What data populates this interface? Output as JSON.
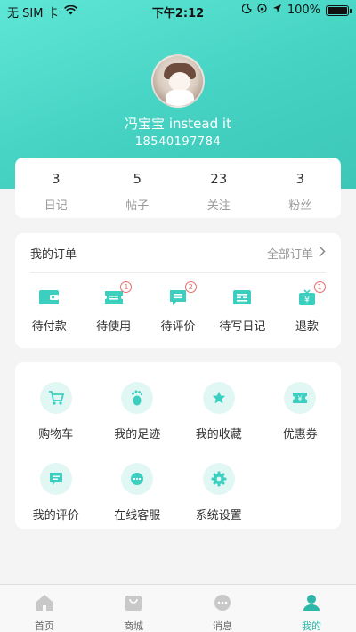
{
  "status_bar": {
    "carrier": "无 SIM 卡",
    "time": "下午2:12",
    "battery": "100%"
  },
  "profile": {
    "name": "冯宝宝 instead it",
    "phone": "18540197784"
  },
  "stats": [
    {
      "value": "3",
      "label": "日记"
    },
    {
      "value": "5",
      "label": "帖子"
    },
    {
      "value": "23",
      "label": "关注"
    },
    {
      "value": "3",
      "label": "粉丝"
    }
  ],
  "orders": {
    "title": "我的订单",
    "all_label": "全部订单",
    "items": [
      {
        "label": "待付款",
        "icon": "wallet-icon"
      },
      {
        "label": "待使用",
        "icon": "ticket-icon",
        "badge": "1"
      },
      {
        "label": "待评价",
        "icon": "comment-icon",
        "badge": "2"
      },
      {
        "label": "待写日记",
        "icon": "diary-icon"
      },
      {
        "label": "退款",
        "icon": "refund-icon",
        "badge": "1"
      }
    ]
  },
  "services": [
    {
      "label": "购物车",
      "icon": "cart-icon"
    },
    {
      "label": "我的足迹",
      "icon": "footprint-icon"
    },
    {
      "label": "我的收藏",
      "icon": "star-icon"
    },
    {
      "label": "优惠券",
      "icon": "coupon-icon"
    },
    {
      "label": "我的评价",
      "icon": "review-icon"
    },
    {
      "label": "在线客服",
      "icon": "chat-icon"
    },
    {
      "label": "系统设置",
      "icon": "gear-icon"
    }
  ],
  "tabbar": [
    {
      "label": "首页",
      "icon": "home-icon"
    },
    {
      "label": "商城",
      "icon": "shop-bag-icon"
    },
    {
      "label": "消息",
      "icon": "message-icon"
    },
    {
      "label": "我的",
      "icon": "user-icon",
      "active": true
    }
  ],
  "colors": {
    "accent": "#3ccfc0",
    "accent_dark": "#2cb7a9",
    "badge": "#e76b6b",
    "icon_bg": "#e1f7f4",
    "tab_inactive": "#c8c8c8"
  }
}
